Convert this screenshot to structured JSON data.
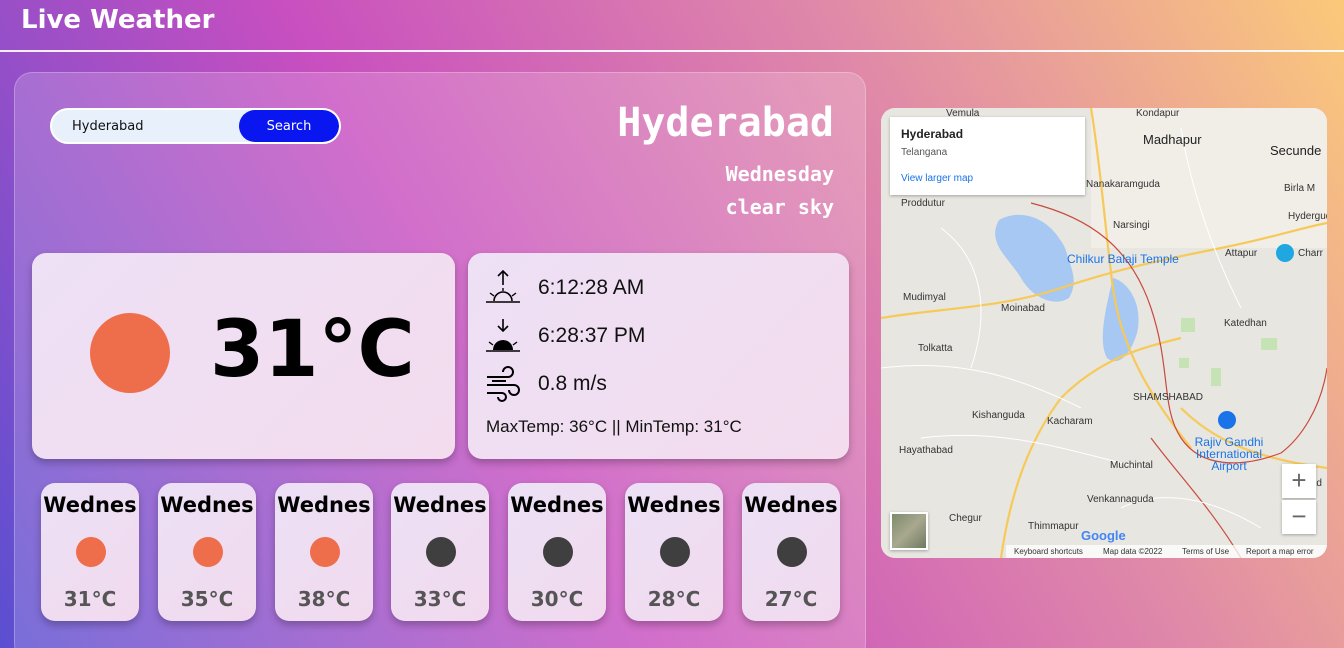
{
  "app": {
    "title": "Live Weather"
  },
  "search": {
    "value": "Hyderabad",
    "button_label": "Search"
  },
  "location": {
    "city": "Hyderabad",
    "day": "Wednesday",
    "description": "clear sky"
  },
  "current": {
    "temperature": "31°C",
    "icon": "sun-icon",
    "icon_color": "#ee6e4c"
  },
  "details": {
    "sunrise": "6:12:28 AM",
    "sunset": "6:28:37 PM",
    "wind": "0.8 m/s",
    "minmax": "MaxTemp: 36°C || MinTemp: 31°C"
  },
  "forecast": [
    {
      "day": "Wednes",
      "temp": "31°C",
      "icon": "sun-icon",
      "color": "#ee6e4c"
    },
    {
      "day": "Wednes",
      "temp": "35°C",
      "icon": "sun-icon",
      "color": "#ee6e4c"
    },
    {
      "day": "Wednes",
      "temp": "38°C",
      "icon": "sun-icon",
      "color": "#ee6e4c"
    },
    {
      "day": "Wednes",
      "temp": "33°C",
      "icon": "moon-icon",
      "color": "#3f3f3f"
    },
    {
      "day": "Wednes",
      "temp": "30°C",
      "icon": "moon-icon",
      "color": "#3f3f3f"
    },
    {
      "day": "Wednes",
      "temp": "28°C",
      "icon": "moon-icon",
      "color": "#3f3f3f"
    },
    {
      "day": "Wednes",
      "temp": "27°C",
      "icon": "moon-icon",
      "color": "#3f3f3f"
    }
  ],
  "map": {
    "info_title": "Hyderabad",
    "info_subtitle": "Telangana",
    "info_link": "View larger map",
    "zoom_in": "+",
    "zoom_out": "−",
    "logo": "Google",
    "footer": [
      "Keyboard shortcuts",
      "Map data ©2022",
      "Terms of Use",
      "Report a map error"
    ],
    "labels": {
      "kondapur": "Kondapur",
      "madhapur": "Madhapur",
      "secunderabad": "Secunde",
      "narsingi": "Narsingi",
      "chilkur": "Chilkur Balaji Temple",
      "attapur": "Attapur",
      "mudimyal": "Mudimyal",
      "moinabad": "Moinabad",
      "katedhan": "Katedhan",
      "tolkatta": "Tolkatta",
      "shamshabad": "SHAMSHABAD",
      "kishanguda": "Kishanguda",
      "kacharam": "Kacharam",
      "rgia": "Rajiv Gandhi International Airport",
      "hayathabad": "Hayathabad",
      "muchintal": "Muchintal",
      "venkannaguda": "Venkannaguda",
      "chegur": "Chegur",
      "thimmapur": "Thimmapur",
      "produttur": "Proddutur",
      "hyderguda": "Hyderguda",
      "malikd": "Malikd",
      "birla": "Birla M",
      "charm": "Charr",
      "nanakaramguda": "Nanakaramguda",
      "vemula": "Vemula"
    }
  }
}
